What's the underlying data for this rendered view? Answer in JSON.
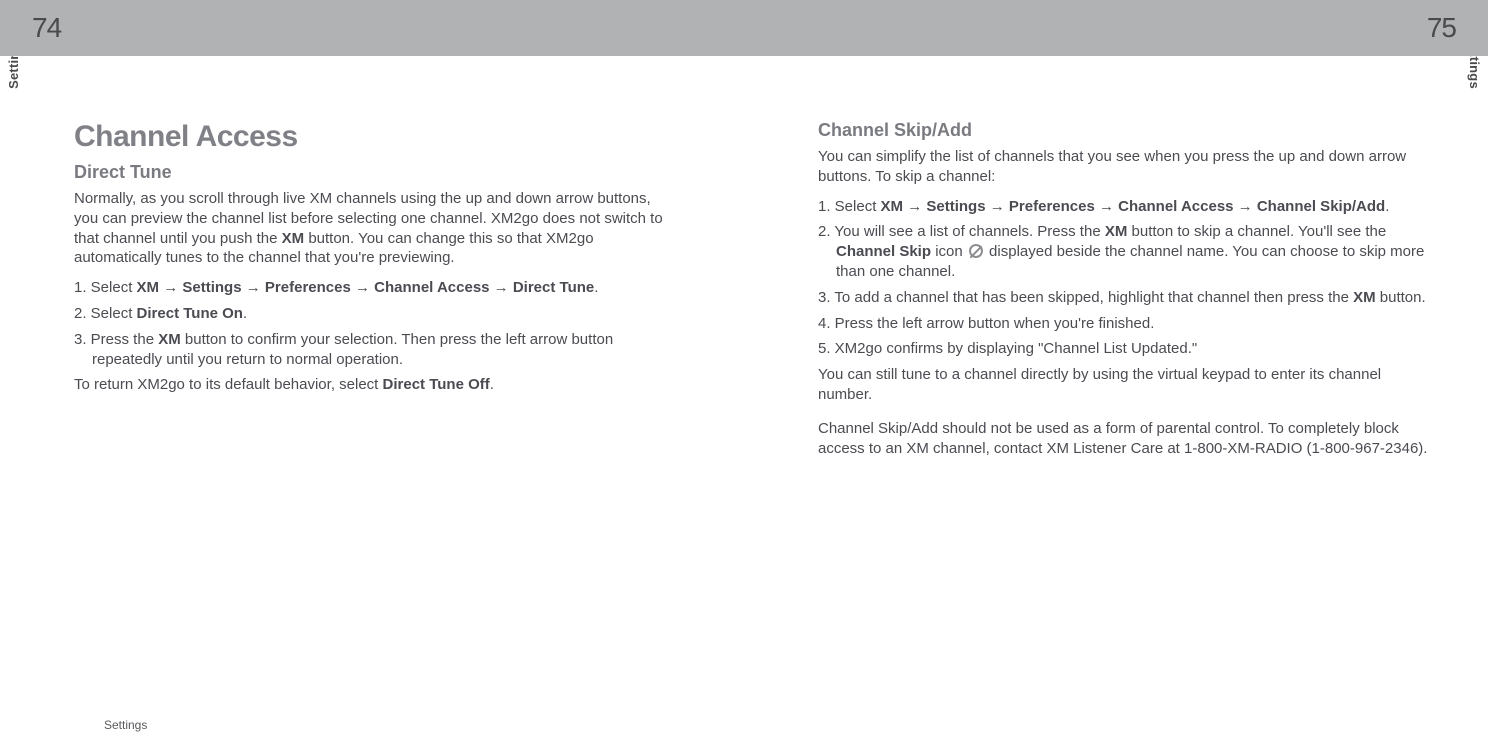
{
  "left_page_number": "74",
  "right_page_number": "75",
  "side_tab_left": "Settings",
  "side_tab_right": "Settings",
  "footer_text": "Settings",
  "arrow": "→",
  "left": {
    "h1": "Channel Access",
    "h2": "Direct Tune",
    "intro_pre": "Normally, as you scroll through live XM channels using the up and down arrow buttons, you can preview the channel list before selecting one channel. XM2go does not switch to that channel until you push the ",
    "intro_bold1": "XM",
    "intro_post": " button. You can change this so that XM2go automatically tunes to the channel that you're previewing.",
    "step1_pre": "1. Select ",
    "step1_path": [
      "XM",
      "Settings",
      "Preferences",
      "Channel Access",
      "Direct Tune"
    ],
    "step2_pre": "2. Select ",
    "step2_bold": "Direct Tune On",
    "step3_pre": "3. Press the ",
    "step3_bold": "XM",
    "step3_post": " button to confirm your selection. Then press the left arrow button repeatedly until you return to normal operation.",
    "closing_pre": "To return XM2go to its default behavior, select ",
    "closing_bold": "Direct Tune Off"
  },
  "right": {
    "h2": "Channel Skip/Add",
    "intro": "You can simplify the list of channels that you see when you press the up and down arrow buttons. To skip a channel:",
    "step1_pre": "1. Select ",
    "step1_path": [
      "XM",
      "Settings",
      "Preferences",
      "Channel Access",
      "Channel Skip/Add"
    ],
    "step2_pre": "2. You will see a list of channels. Press the ",
    "step2_bold1": "XM",
    "step2_mid": " button to skip a channel. You'll see the ",
    "step2_bold2": "Channel Skip",
    "step2_post_icon_pre": " icon ",
    "step2_post_icon_post": " displayed beside the channel name. You can choose to skip more than one channel.",
    "step3_pre": "3. To add a channel that has been skipped, highlight that channel then press the ",
    "step3_bold": "XM",
    "step3_post": " button.",
    "step4": "4. Press the left arrow button when you're finished.",
    "step5": "5. XM2go confirms by displaying \"Channel List Updated.\"",
    "after": "You can still tune to a channel directly by using the virtual keypad to enter its channel number.",
    "note": "Channel Skip/Add should not be used as a form of parental control. To completely block access to an XM channel, contact XM Listener Care at 1-800-XM-RADIO (1-800-967-2346)."
  }
}
